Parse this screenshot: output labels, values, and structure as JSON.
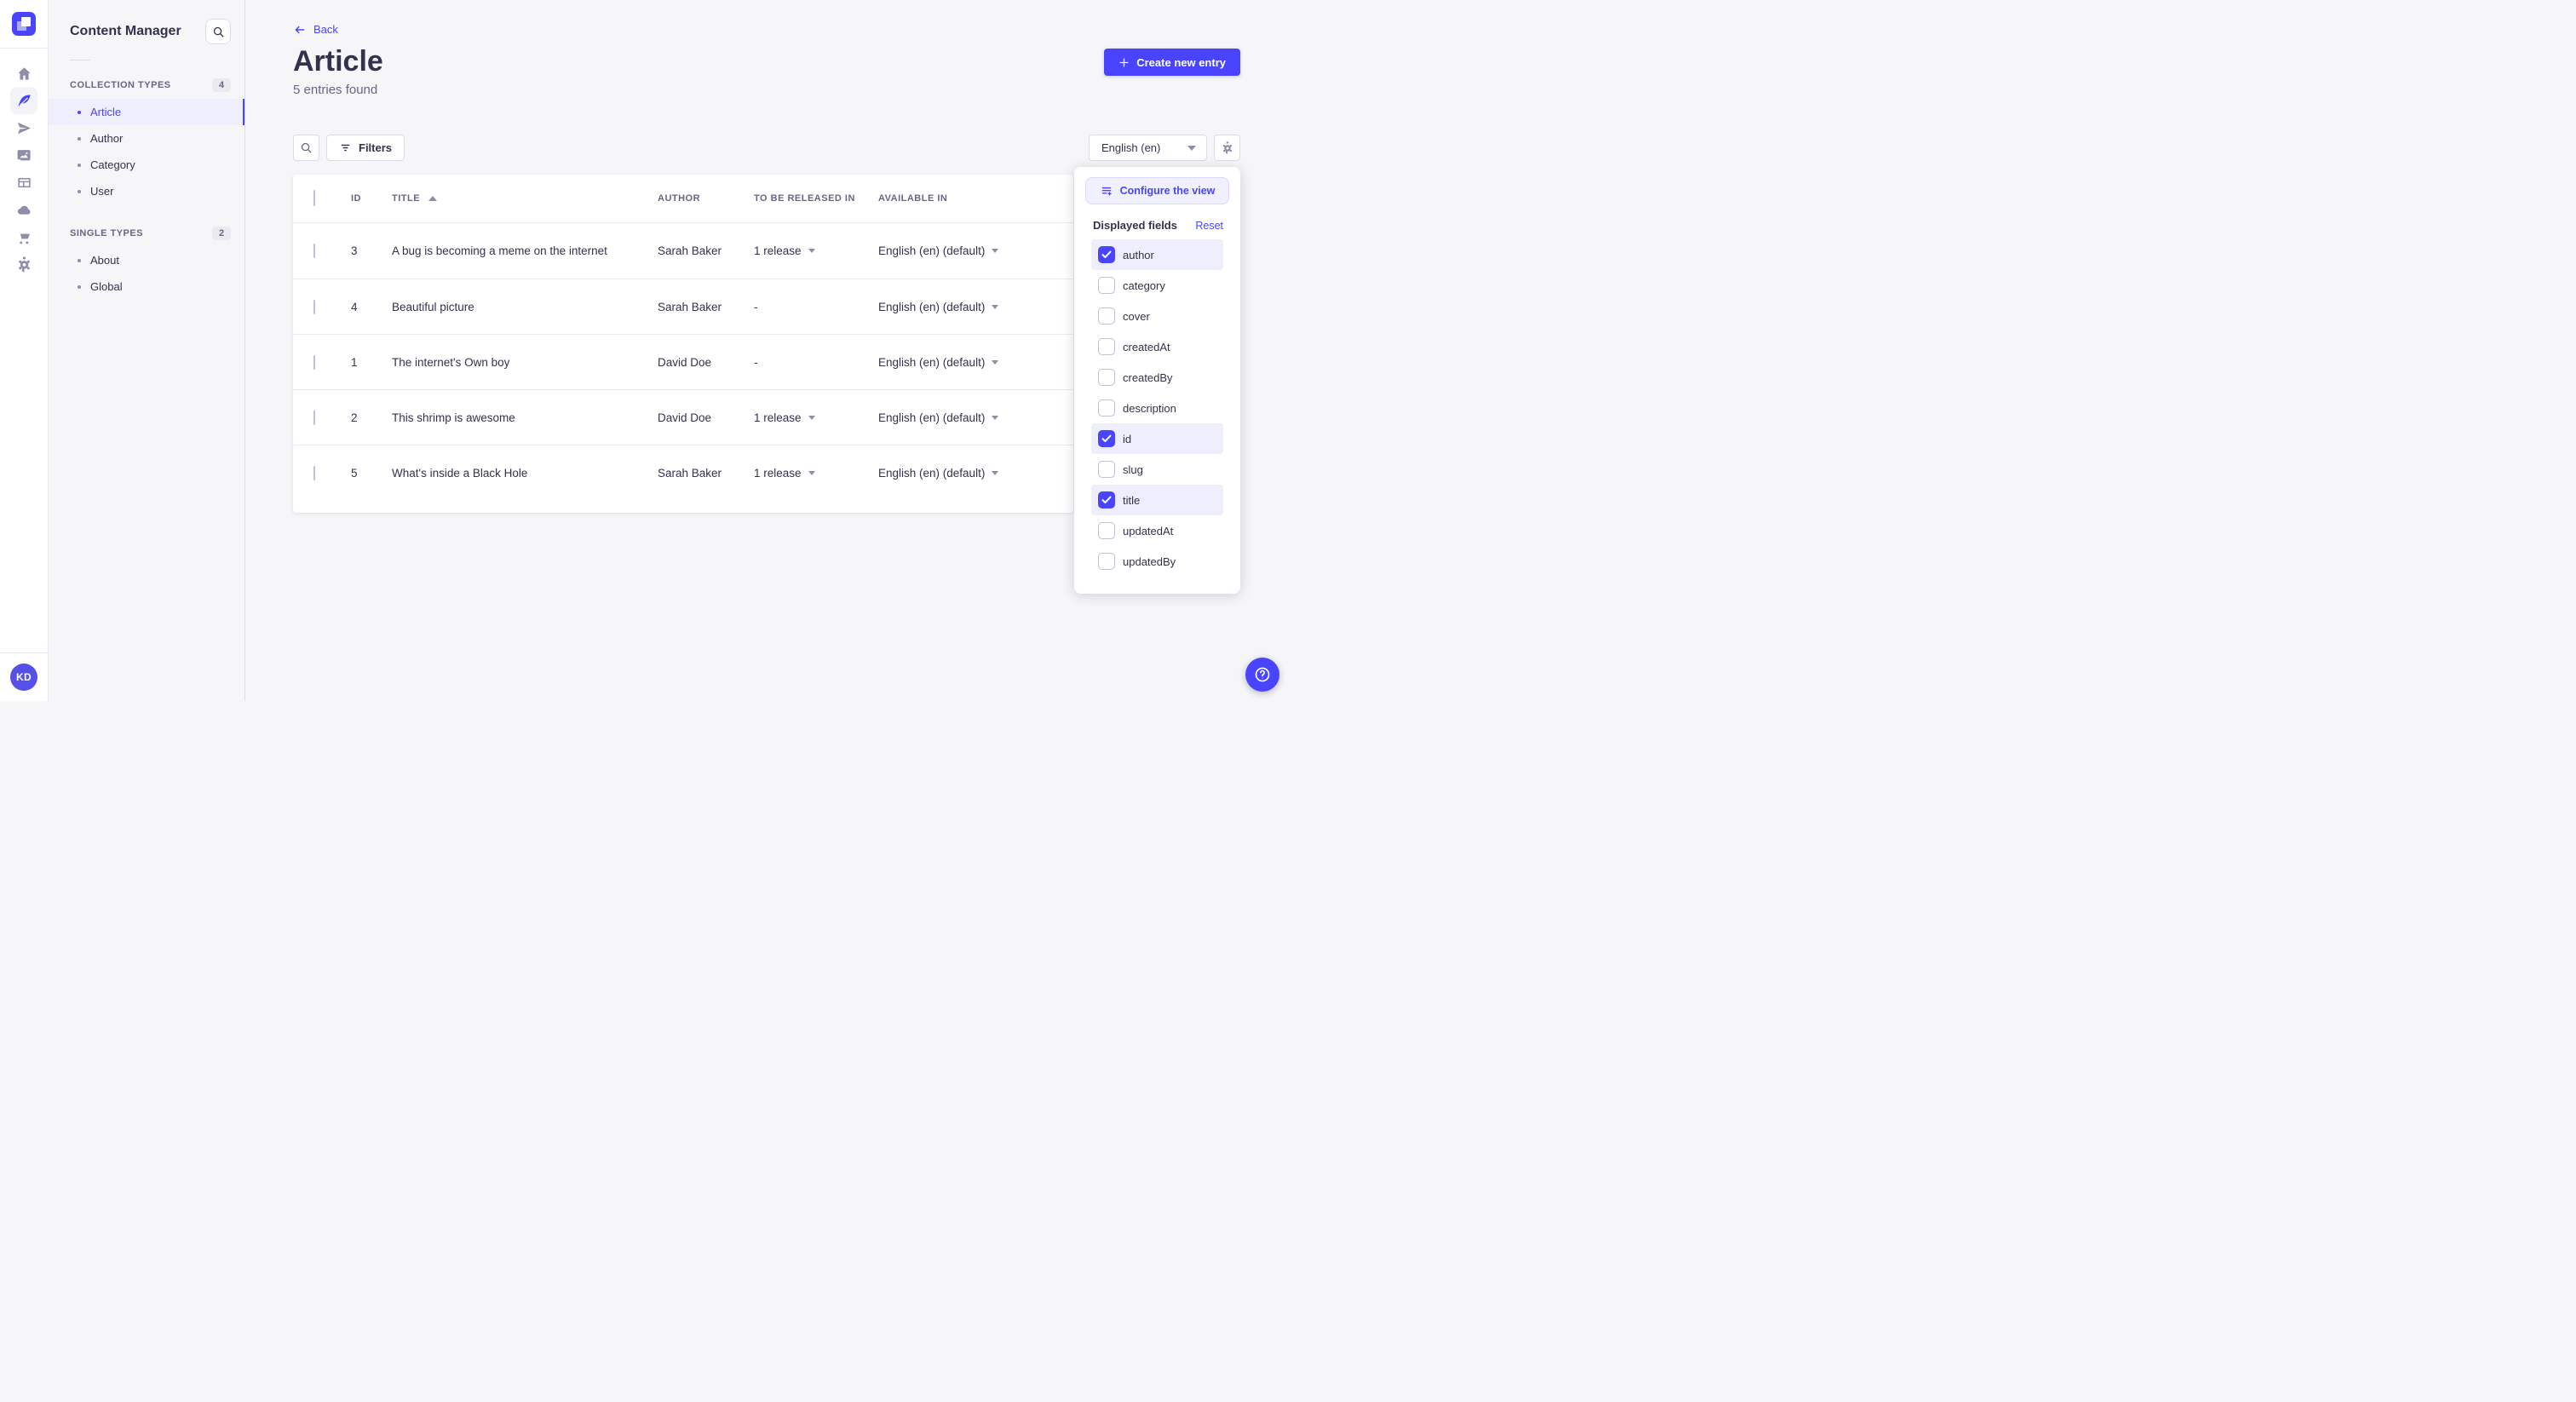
{
  "colors": {
    "primary": "#4945ff",
    "primary_light_bg": "#f0f0ff",
    "primary_border": "#d9d8ff",
    "text_dark": "#32324d",
    "text_muted": "#666687",
    "icon_gray": "#8e8ea9",
    "background": "#f6f6f9",
    "border": "#eaeaef"
  },
  "rail": {
    "logo_icon": "strapi-logo",
    "icons": [
      "home-icon",
      "content-feather-icon",
      "release-plane-icon",
      "media-images-icon",
      "layout-icon",
      "cloud-icon",
      "cart-icon",
      "settings-gear-icon"
    ],
    "active_icon": "content-feather-icon",
    "avatar_initials": "KD"
  },
  "subnav": {
    "title": "Content Manager",
    "search_icon": "search-icon",
    "sections": [
      {
        "label": "COLLECTION TYPES",
        "count": "4",
        "items": [
          {
            "label": "Article",
            "active": true
          },
          {
            "label": "Author",
            "active": false
          },
          {
            "label": "Category",
            "active": false
          },
          {
            "label": "User",
            "active": false
          }
        ]
      },
      {
        "label": "SINGLE TYPES",
        "count": "2",
        "items": [
          {
            "label": "About",
            "active": false
          },
          {
            "label": "Global",
            "active": false
          }
        ]
      }
    ]
  },
  "header": {
    "back_label": "Back",
    "title": "Article",
    "subtitle": "5 entries found",
    "create_button_label": "Create new entry"
  },
  "toolbar": {
    "search_icon": "search-icon",
    "filters_label": "Filters",
    "locale_value": "English (en)",
    "settings_icon": "gear-icon"
  },
  "table": {
    "columns": {
      "id": "ID",
      "title": "TITLE",
      "author": "AUTHOR",
      "release": "TO BE RELEASED IN",
      "available": "AVAILABLE IN"
    },
    "sorted_column": "TITLE",
    "sort_direction": "ascending",
    "rows": [
      {
        "id": "3",
        "title": "A bug is becoming a meme on the internet",
        "author": "Sarah Baker",
        "release": "1 release",
        "available": "English (en) (default)"
      },
      {
        "id": "4",
        "title": "Beautiful picture",
        "author": "Sarah Baker",
        "release": "-",
        "available": "English (en) (default)"
      },
      {
        "id": "1",
        "title": "The internet's Own boy",
        "author": "David Doe",
        "release": "-",
        "available": "English (en) (default)"
      },
      {
        "id": "2",
        "title": "This shrimp is awesome",
        "author": "David Doe",
        "release": "1 release",
        "available": "English (en) (default)"
      },
      {
        "id": "5",
        "title": "What's inside a Black Hole",
        "author": "Sarah Baker",
        "release": "1 release",
        "available": "English (en) (default)"
      }
    ]
  },
  "view_panel": {
    "configure_label": "Configure the view",
    "fields_title": "Displayed fields",
    "reset_label": "Reset",
    "fields": [
      {
        "label": "author",
        "checked": true
      },
      {
        "label": "category",
        "checked": false
      },
      {
        "label": "cover",
        "checked": false
      },
      {
        "label": "createdAt",
        "checked": false
      },
      {
        "label": "createdBy",
        "checked": false
      },
      {
        "label": "description",
        "checked": false
      },
      {
        "label": "id",
        "checked": true
      },
      {
        "label": "slug",
        "checked": false
      },
      {
        "label": "title",
        "checked": true
      },
      {
        "label": "updatedAt",
        "checked": false
      },
      {
        "label": "updatedBy",
        "checked": false
      }
    ]
  },
  "fab": {
    "help_glyph": "?"
  }
}
